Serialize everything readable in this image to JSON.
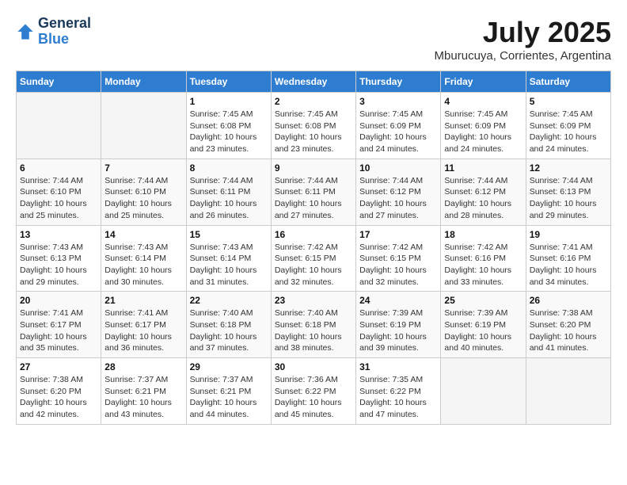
{
  "header": {
    "logo_line1": "General",
    "logo_line2": "Blue",
    "month": "July 2025",
    "location": "Mburucuya, Corrientes, Argentina"
  },
  "weekdays": [
    "Sunday",
    "Monday",
    "Tuesday",
    "Wednesday",
    "Thursday",
    "Friday",
    "Saturday"
  ],
  "weeks": [
    [
      {
        "day": "",
        "info": ""
      },
      {
        "day": "",
        "info": ""
      },
      {
        "day": "1",
        "info": "Sunrise: 7:45 AM\nSunset: 6:08 PM\nDaylight: 10 hours and 23 minutes."
      },
      {
        "day": "2",
        "info": "Sunrise: 7:45 AM\nSunset: 6:08 PM\nDaylight: 10 hours and 23 minutes."
      },
      {
        "day": "3",
        "info": "Sunrise: 7:45 AM\nSunset: 6:09 PM\nDaylight: 10 hours and 24 minutes."
      },
      {
        "day": "4",
        "info": "Sunrise: 7:45 AM\nSunset: 6:09 PM\nDaylight: 10 hours and 24 minutes."
      },
      {
        "day": "5",
        "info": "Sunrise: 7:45 AM\nSunset: 6:09 PM\nDaylight: 10 hours and 24 minutes."
      }
    ],
    [
      {
        "day": "6",
        "info": "Sunrise: 7:44 AM\nSunset: 6:10 PM\nDaylight: 10 hours and 25 minutes."
      },
      {
        "day": "7",
        "info": "Sunrise: 7:44 AM\nSunset: 6:10 PM\nDaylight: 10 hours and 25 minutes."
      },
      {
        "day": "8",
        "info": "Sunrise: 7:44 AM\nSunset: 6:11 PM\nDaylight: 10 hours and 26 minutes."
      },
      {
        "day": "9",
        "info": "Sunrise: 7:44 AM\nSunset: 6:11 PM\nDaylight: 10 hours and 27 minutes."
      },
      {
        "day": "10",
        "info": "Sunrise: 7:44 AM\nSunset: 6:12 PM\nDaylight: 10 hours and 27 minutes."
      },
      {
        "day": "11",
        "info": "Sunrise: 7:44 AM\nSunset: 6:12 PM\nDaylight: 10 hours and 28 minutes."
      },
      {
        "day": "12",
        "info": "Sunrise: 7:44 AM\nSunset: 6:13 PM\nDaylight: 10 hours and 29 minutes."
      }
    ],
    [
      {
        "day": "13",
        "info": "Sunrise: 7:43 AM\nSunset: 6:13 PM\nDaylight: 10 hours and 29 minutes."
      },
      {
        "day": "14",
        "info": "Sunrise: 7:43 AM\nSunset: 6:14 PM\nDaylight: 10 hours and 30 minutes."
      },
      {
        "day": "15",
        "info": "Sunrise: 7:43 AM\nSunset: 6:14 PM\nDaylight: 10 hours and 31 minutes."
      },
      {
        "day": "16",
        "info": "Sunrise: 7:42 AM\nSunset: 6:15 PM\nDaylight: 10 hours and 32 minutes."
      },
      {
        "day": "17",
        "info": "Sunrise: 7:42 AM\nSunset: 6:15 PM\nDaylight: 10 hours and 32 minutes."
      },
      {
        "day": "18",
        "info": "Sunrise: 7:42 AM\nSunset: 6:16 PM\nDaylight: 10 hours and 33 minutes."
      },
      {
        "day": "19",
        "info": "Sunrise: 7:41 AM\nSunset: 6:16 PM\nDaylight: 10 hours and 34 minutes."
      }
    ],
    [
      {
        "day": "20",
        "info": "Sunrise: 7:41 AM\nSunset: 6:17 PM\nDaylight: 10 hours and 35 minutes."
      },
      {
        "day": "21",
        "info": "Sunrise: 7:41 AM\nSunset: 6:17 PM\nDaylight: 10 hours and 36 minutes."
      },
      {
        "day": "22",
        "info": "Sunrise: 7:40 AM\nSunset: 6:18 PM\nDaylight: 10 hours and 37 minutes."
      },
      {
        "day": "23",
        "info": "Sunrise: 7:40 AM\nSunset: 6:18 PM\nDaylight: 10 hours and 38 minutes."
      },
      {
        "day": "24",
        "info": "Sunrise: 7:39 AM\nSunset: 6:19 PM\nDaylight: 10 hours and 39 minutes."
      },
      {
        "day": "25",
        "info": "Sunrise: 7:39 AM\nSunset: 6:19 PM\nDaylight: 10 hours and 40 minutes."
      },
      {
        "day": "26",
        "info": "Sunrise: 7:38 AM\nSunset: 6:20 PM\nDaylight: 10 hours and 41 minutes."
      }
    ],
    [
      {
        "day": "27",
        "info": "Sunrise: 7:38 AM\nSunset: 6:20 PM\nDaylight: 10 hours and 42 minutes."
      },
      {
        "day": "28",
        "info": "Sunrise: 7:37 AM\nSunset: 6:21 PM\nDaylight: 10 hours and 43 minutes."
      },
      {
        "day": "29",
        "info": "Sunrise: 7:37 AM\nSunset: 6:21 PM\nDaylight: 10 hours and 44 minutes."
      },
      {
        "day": "30",
        "info": "Sunrise: 7:36 AM\nSunset: 6:22 PM\nDaylight: 10 hours and 45 minutes."
      },
      {
        "day": "31",
        "info": "Sunrise: 7:35 AM\nSunset: 6:22 PM\nDaylight: 10 hours and 47 minutes."
      },
      {
        "day": "",
        "info": ""
      },
      {
        "day": "",
        "info": ""
      }
    ]
  ]
}
